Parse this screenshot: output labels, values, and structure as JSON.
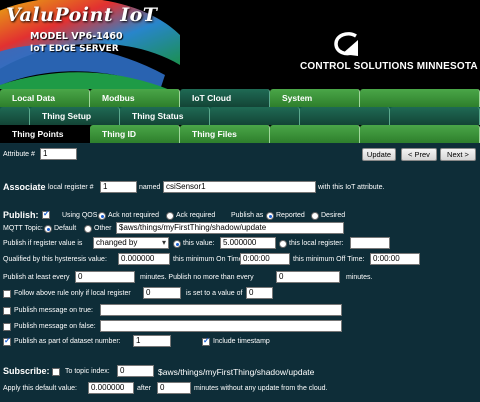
{
  "brand": {
    "title": "ValuPoint IoT",
    "model": "MODEL VP6-1460",
    "subtitle": "IoT EDGE SERVER",
    "company": "CONTROL SOLUTIONS MINNESOTA"
  },
  "nav": {
    "row1": [
      "Local Data",
      "Modbus",
      "IoT Cloud",
      "System"
    ],
    "row2": [
      "Thing Setup",
      "Thing Status"
    ],
    "row3": [
      "Thing Points",
      "Thing ID",
      "Thing Files"
    ]
  },
  "attribute": {
    "label": "Attribute #",
    "value": "1",
    "update": "Update",
    "prev": "< Prev",
    "next": "Next >"
  },
  "associate": {
    "title": "Associate",
    "local_label": "local register #",
    "local_value": "1",
    "named_label": "named",
    "name_value": "csiSensor1",
    "suffix": "with this IoT attribute."
  },
  "publish": {
    "title": "Publish:",
    "using_qos": "Using QOS",
    "ack_not": "Ack not required",
    "ack_req": "Ack required",
    "publish_as": "Publish as",
    "reported": "Reported",
    "desired": "Desired",
    "mqtt_label": "MQTT Topic:",
    "default": "Default",
    "other": "Other",
    "topic_value": "$aws/things/myFirstThing/shadow/update",
    "if_label": "Publish if register value is",
    "condition": "changed by",
    "this_value": "this value:",
    "this_value_val": "5.000000",
    "this_local": "this local register:",
    "hyst_label": "Qualified by this hysteresis value:",
    "hyst_value": "0.000000",
    "min_on_label": "this minimum On Time:",
    "min_on_value": "0:00:00",
    "min_off_label": "this minimum Off Time:",
    "min_off_value": "0:00:00",
    "atleast_label": "Publish at least every",
    "atleast_value": "0",
    "minutes_mid": "minutes. Publish no more than every",
    "nomore_value": "0",
    "minutes_end": "minutes.",
    "follow_label": "Follow above rule only if local register",
    "follow_reg": "0",
    "follow_mid": "is set to a value of",
    "follow_val": "0",
    "on_true": "Publish message on true:",
    "on_false": "Publish message on false:",
    "dataset_label": "Publish as part of dataset number:",
    "dataset_value": "1",
    "timestamp": "Include timestamp"
  },
  "subscribe": {
    "title": "Subscribe:",
    "topic_index": "To topic index:",
    "index_value": "0",
    "topic": "$aws/things/myFirstThing/shadow/update",
    "apply_label": "Apply this default value:",
    "apply_value": "0.000000",
    "after": "after",
    "after_value": "0",
    "after_suffix": "minutes without any update from the cloud."
  }
}
